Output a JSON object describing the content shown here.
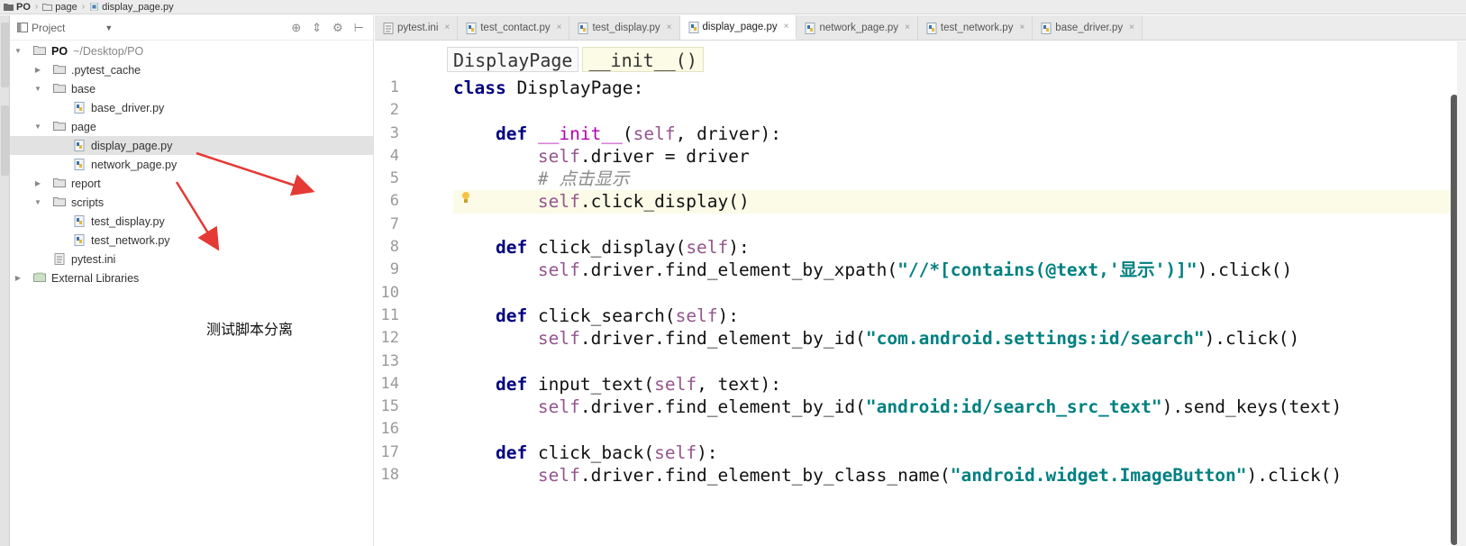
{
  "breadcrumb": [
    {
      "label": "PO"
    },
    {
      "label": "page"
    },
    {
      "label": "display_page.py"
    }
  ],
  "project_panel": {
    "title": "Project",
    "tree": [
      {
        "label": "PO",
        "suffix": "~/Desktop/PO",
        "bold": true,
        "depth": 0,
        "arrow": "▼",
        "icon": "folder-icon"
      },
      {
        "label": ".pytest_cache",
        "depth": 1,
        "arrow": "▶",
        "icon": "folder-icon"
      },
      {
        "label": "base",
        "depth": 1,
        "arrow": "▼",
        "icon": "folder-icon"
      },
      {
        "label": "base_driver.py",
        "depth": 2,
        "arrow": "",
        "icon": "python-file-icon"
      },
      {
        "label": "page",
        "depth": 1,
        "arrow": "▼",
        "icon": "folder-icon"
      },
      {
        "label": "display_page.py",
        "depth": 2,
        "arrow": "",
        "icon": "python-file-icon",
        "selected": true
      },
      {
        "label": "network_page.py",
        "depth": 2,
        "arrow": "",
        "icon": "python-file-icon"
      },
      {
        "label": "report",
        "depth": 1,
        "arrow": "▶",
        "icon": "folder-icon"
      },
      {
        "label": "scripts",
        "depth": 1,
        "arrow": "▼",
        "icon": "folder-icon"
      },
      {
        "label": "test_display.py",
        "depth": 2,
        "arrow": "",
        "icon": "python-file-icon"
      },
      {
        "label": "test_network.py",
        "depth": 2,
        "arrow": "",
        "icon": "python-file-icon"
      },
      {
        "label": "pytest.ini",
        "depth": 1,
        "arrow": "",
        "icon": "ini-file-icon"
      },
      {
        "label": "External Libraries",
        "depth": 0,
        "arrow": "▶",
        "icon": "library-icon"
      }
    ]
  },
  "annotation": "测试脚本分离",
  "tabs": [
    {
      "label": "pytest.ini",
      "icon": "ini-file-icon"
    },
    {
      "label": "test_contact.py",
      "icon": "python-file-icon"
    },
    {
      "label": "test_display.py",
      "icon": "python-file-icon"
    },
    {
      "label": "display_page.py",
      "icon": "python-file-icon",
      "active": true
    },
    {
      "label": "network_page.py",
      "icon": "python-file-icon"
    },
    {
      "label": "test_network.py",
      "icon": "python-file-icon"
    },
    {
      "label": "base_driver.py",
      "icon": "python-file-icon"
    }
  ],
  "editor": {
    "crumbs": [
      "DisplayPage",
      "__init__()"
    ],
    "line_numbers": [
      "1",
      "2",
      "3",
      "4",
      "5",
      "6",
      "7",
      "8",
      "9",
      "10",
      "11",
      "12",
      "13",
      "14",
      "15",
      "16",
      "17",
      "18"
    ],
    "current_line": 6,
    "lines": [
      [
        [
          "kw",
          "class"
        ],
        [
          "t",
          " DisplayPage:"
        ]
      ],
      [],
      [
        [
          "t",
          "    "
        ],
        [
          "kw",
          "def"
        ],
        [
          "t",
          " "
        ],
        [
          "dunder",
          "__init__"
        ],
        [
          "t",
          "("
        ],
        [
          "self",
          "self"
        ],
        [
          "t",
          ", driver):"
        ]
      ],
      [
        [
          "t",
          "        "
        ],
        [
          "self",
          "self"
        ],
        [
          "t",
          ".driver = driver"
        ]
      ],
      [
        [
          "t",
          "        "
        ],
        [
          "cmt",
          "# 点击显示"
        ]
      ],
      [
        [
          "t",
          "        "
        ],
        [
          "self",
          "self"
        ],
        [
          "t",
          ".click_display()"
        ]
      ],
      [],
      [
        [
          "t",
          "    "
        ],
        [
          "kw",
          "def"
        ],
        [
          "t",
          " click_display("
        ],
        [
          "self",
          "self"
        ],
        [
          "t",
          "):"
        ]
      ],
      [
        [
          "t",
          "        "
        ],
        [
          "self",
          "self"
        ],
        [
          "t",
          ".driver.find_element_by_xpath("
        ],
        [
          "str",
          "\"//*[contains(@text,'显示')]\""
        ],
        [
          "t",
          ").click()"
        ]
      ],
      [],
      [
        [
          "t",
          "    "
        ],
        [
          "kw",
          "def"
        ],
        [
          "t",
          " click_search("
        ],
        [
          "self",
          "self"
        ],
        [
          "t",
          "):"
        ]
      ],
      [
        [
          "t",
          "        "
        ],
        [
          "self",
          "self"
        ],
        [
          "t",
          ".driver.find_element_by_id("
        ],
        [
          "str",
          "\"com.android.settings:id/search\""
        ],
        [
          "t",
          ").click()"
        ]
      ],
      [],
      [
        [
          "t",
          "    "
        ],
        [
          "kw",
          "def"
        ],
        [
          "t",
          " input_text("
        ],
        [
          "self",
          "self"
        ],
        [
          "t",
          ", text):"
        ]
      ],
      [
        [
          "t",
          "        "
        ],
        [
          "self",
          "self"
        ],
        [
          "t",
          ".driver.find_element_by_id("
        ],
        [
          "str",
          "\"android:id/search_src_text\""
        ],
        [
          "t",
          ").send_keys(text)"
        ]
      ],
      [],
      [
        [
          "t",
          "    "
        ],
        [
          "kw",
          "def"
        ],
        [
          "t",
          " click_back("
        ],
        [
          "self",
          "self"
        ],
        [
          "t",
          "):"
        ]
      ],
      [
        [
          "t",
          "        "
        ],
        [
          "self",
          "self"
        ],
        [
          "t",
          ".driver.find_element_by_class_name("
        ],
        [
          "str",
          "\"android.widget.ImageButton\""
        ],
        [
          "t",
          ").click()"
        ]
      ]
    ]
  },
  "colors": {
    "keyword": "#000080",
    "self": "#94558d",
    "string": "#008080",
    "comment": "#8c8c8c",
    "dunder": "#b200b2",
    "arrow_annotation": "#e53935",
    "current_line": "#fbfbe8"
  }
}
